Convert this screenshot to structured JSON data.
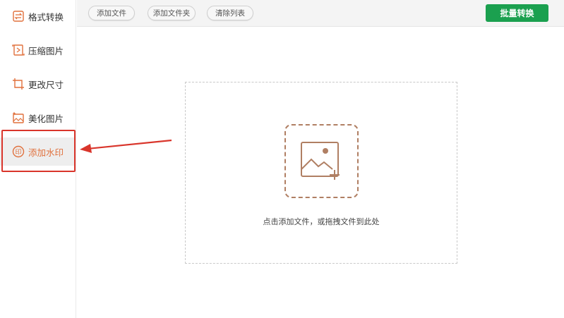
{
  "sidebar": {
    "items": [
      {
        "label": "格式转换",
        "icon": "format-convert-icon"
      },
      {
        "label": "压缩图片",
        "icon": "compress-image-icon"
      },
      {
        "label": "更改尺寸",
        "icon": "resize-icon"
      },
      {
        "label": "美化图片",
        "icon": "beautify-image-icon"
      },
      {
        "label": "添加水印",
        "icon": "watermark-icon",
        "active": true
      }
    ]
  },
  "toolbar": {
    "add_file": "添加文件",
    "add_folder": "添加文件夹",
    "clear_list": "清除列表",
    "batch_convert": "批量转换"
  },
  "dropzone": {
    "hint": "点击添加文件，或拖拽文件到此处",
    "icon": "add-image-icon"
  },
  "colors": {
    "accent": "#e0703c",
    "primary": "#1ba04f",
    "highlight": "#d9352b"
  }
}
